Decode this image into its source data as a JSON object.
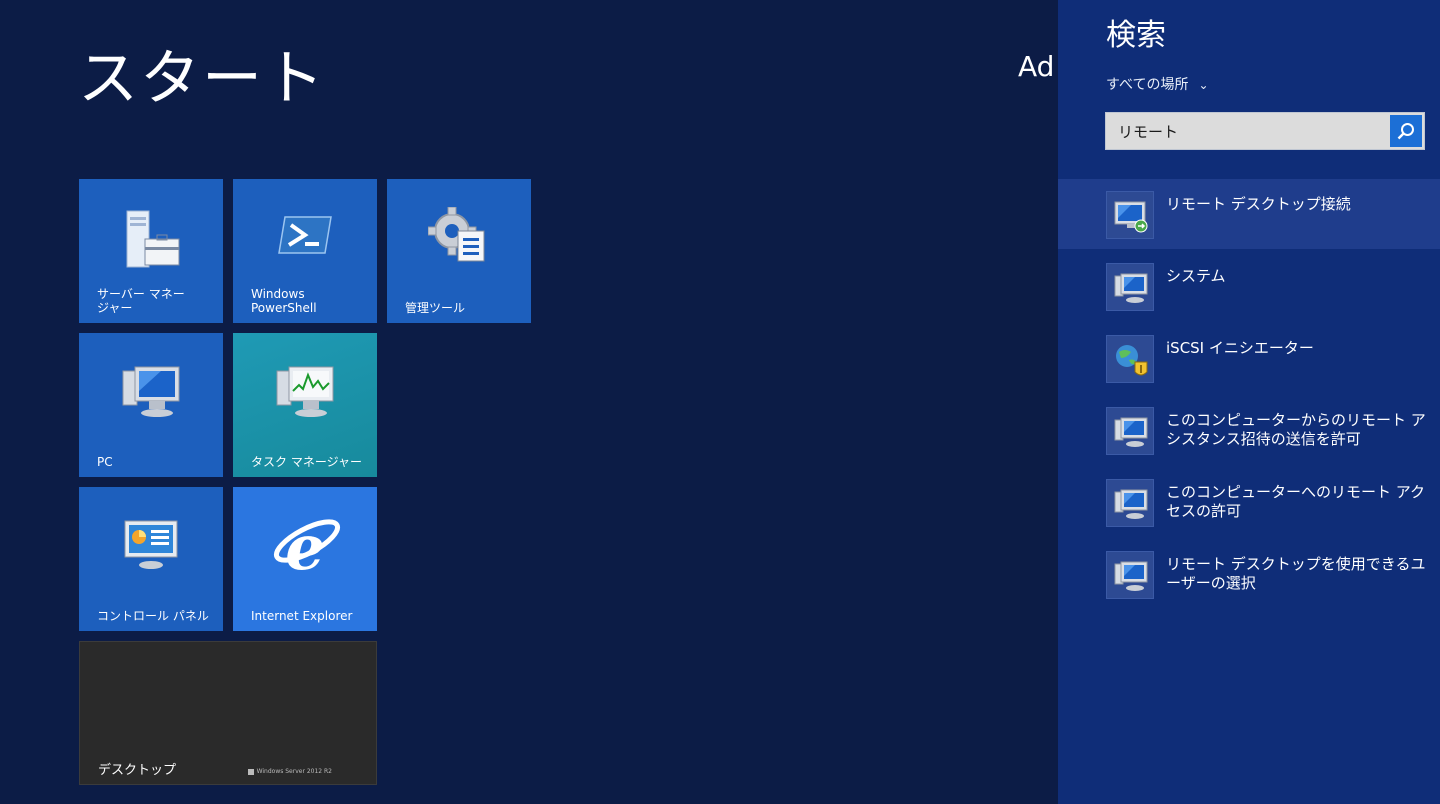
{
  "start": {
    "title": "スタート",
    "user": "Ad"
  },
  "tiles": [
    {
      "label": "サーバー マネー\nジャー",
      "icon": "server-manager-icon"
    },
    {
      "label": "Windows\nPowerShell",
      "icon": "powershell-icon"
    },
    {
      "label": "管理ツール",
      "icon": "admin-tools-icon"
    },
    {
      "label": "PC",
      "icon": "pc-icon"
    },
    {
      "label": "タスク マネージャー",
      "icon": "task-manager-icon"
    },
    {
      "label": "コントロール パネル",
      "icon": "control-panel-icon"
    },
    {
      "label": "Internet Explorer",
      "icon": "internet-explorer-icon"
    },
    {
      "label": "デスクトップ",
      "brand": "Windows Server 2012 R2"
    }
  ],
  "search": {
    "title": "検索",
    "scope": "すべての場所",
    "query": "リモート",
    "results": [
      {
        "label": "リモート デスクトップ接続",
        "icon": "remote-desktop-icon",
        "selected": true
      },
      {
        "label": "システム",
        "icon": "system-icon"
      },
      {
        "label": "iSCSI イニシエーター",
        "icon": "iscsi-initiator-icon"
      },
      {
        "label": "このコンピューターからのリモート アシスタンス招待の送信を許可",
        "icon": "system-icon"
      },
      {
        "label": "このコンピューターへのリモート アクセスの許可",
        "icon": "system-icon"
      },
      {
        "label": "リモート デスクトップを使用できるユーザーの選択",
        "icon": "system-icon"
      }
    ]
  }
}
